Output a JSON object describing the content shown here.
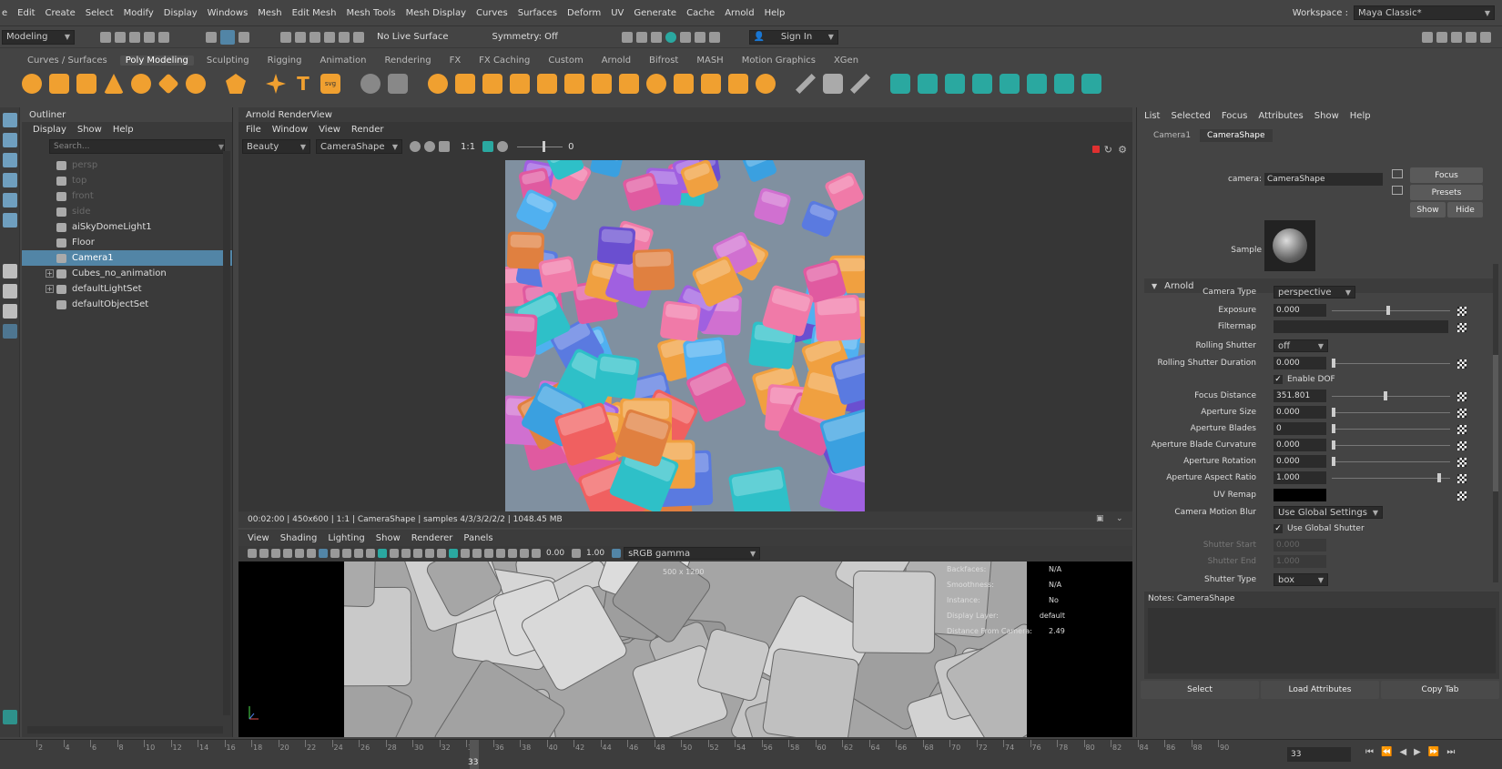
{
  "menubar": {
    "items": [
      "e",
      "Edit",
      "Create",
      "Select",
      "Modify",
      "Display",
      "Windows",
      "Mesh",
      "Edit Mesh",
      "Mesh Tools",
      "Mesh Display",
      "Curves",
      "Surfaces",
      "Deform",
      "UV",
      "Generate",
      "Cache",
      "Arnold",
      "Help"
    ],
    "workspace_label": "Workspace :",
    "workspace_value": "Maya Classic*"
  },
  "statusline": {
    "mode": "Modeling",
    "live_surface": "No Live Surface",
    "symmetry": "Symmetry: Off",
    "sign_in": "Sign In"
  },
  "shelf": {
    "tabs": [
      "Curves / Surfaces",
      "Poly Modeling",
      "Sculpting",
      "Rigging",
      "Animation",
      "Rendering",
      "FX",
      "FX Caching",
      "Custom",
      "Arnold",
      "Bifrost",
      "MASH",
      "Motion Graphics",
      "XGen"
    ],
    "active_tab": "Poly Modeling"
  },
  "outliner": {
    "title": "Outliner",
    "menu": [
      "Display",
      "Show",
      "Help"
    ],
    "search_placeholder": "Search...",
    "items": [
      {
        "label": "persp",
        "dim": true
      },
      {
        "label": "top",
        "dim": true
      },
      {
        "label": "front",
        "dim": true
      },
      {
        "label": "side",
        "dim": true
      },
      {
        "label": "aiSkyDomeLight1",
        "dim": false
      },
      {
        "label": "Floor",
        "dim": false
      },
      {
        "label": "Camera1",
        "dim": false,
        "selected": true
      },
      {
        "label": "Cubes_no_animation",
        "dim": false,
        "expandable": true
      },
      {
        "label": "defaultLightSet",
        "dim": false,
        "expandable": true
      },
      {
        "label": "defaultObjectSet",
        "dim": false
      }
    ]
  },
  "renderview": {
    "title": "Arnold RenderView",
    "menu": [
      "File",
      "Window",
      "View",
      "Render"
    ],
    "aov": "Beauty",
    "camera": "CameraShape",
    "ratio": "1:1",
    "slider_value": "0",
    "status": "00:02:00 | 450x600 | 1:1 | CameraShape  | samples 4/3/3/2/2/2 | 1048.45 MB"
  },
  "viewport": {
    "menu": [
      "View",
      "Shading",
      "Lighting",
      "Show",
      "Renderer",
      "Panels"
    ],
    "exposure": "0.00",
    "gamma": "1.00",
    "colorspace": "sRGB gamma",
    "resolution": "500 x 1200",
    "hud": [
      {
        "label": "Backfaces:",
        "value": "N/A"
      },
      {
        "label": "Smoothness:",
        "value": "N/A"
      },
      {
        "label": "Instance:",
        "value": "No"
      },
      {
        "label": "Display Layer:",
        "value": "default"
      },
      {
        "label": "Distance From Camera:",
        "value": "2.49"
      }
    ]
  },
  "attreditor": {
    "menu": [
      "List",
      "Selected",
      "Focus",
      "Attributes",
      "Show",
      "Help"
    ],
    "tabs": [
      "Camera1",
      "CameraShape"
    ],
    "camera_label": "camera:",
    "camera_value": "CameraShape",
    "focus_btn": "Focus",
    "presets_btn": "Presets",
    "show_btn": "Show",
    "hide_btn": "Hide",
    "sample_label": "Sample",
    "section": "Arnold",
    "camera_type_label": "Camera Type",
    "camera_type_value": "perspective",
    "attrs": [
      {
        "label": "Exposure",
        "value": "0.000",
        "knob": 0.48
      },
      {
        "label": "Filtermap",
        "value": "",
        "knob": null
      },
      {
        "label": "Rolling Shutter",
        "value": "off",
        "dropdown": true
      },
      {
        "label": "Rolling Shutter Duration",
        "value": "0.000",
        "knob": 0.0
      },
      {
        "label": "Focus Distance",
        "value": "351.801",
        "knob": 0.45
      },
      {
        "label": "Aperture Size",
        "value": "0.000",
        "knob": 0.0
      },
      {
        "label": "Aperture Blades",
        "value": "0",
        "knob": 0.0
      },
      {
        "label": "Aperture Blade Curvature",
        "value": "0.000",
        "knob": 0.0
      },
      {
        "label": "Aperture Rotation",
        "value": "0.000",
        "knob": 0.0
      },
      {
        "label": "Aperture Aspect Ratio",
        "value": "1.000",
        "knob": 0.92
      },
      {
        "label": "UV Remap",
        "value": "",
        "knob": null
      }
    ],
    "enable_dof": "Enable DOF",
    "motion_blur_label": "Camera Motion Blur",
    "motion_blur_value": "Use Global Settings",
    "use_global_shutter": "Use Global Shutter",
    "shutter_start_label": "Shutter Start",
    "shutter_start_value": "0.000",
    "shutter_end_label": "Shutter End",
    "shutter_end_value": "1.000",
    "shutter_type_label": "Shutter Type",
    "shutter_type_value": "box",
    "notes": "Notes:  CameraShape",
    "buttons": [
      "Select",
      "Load Attributes",
      "Copy Tab"
    ]
  },
  "timeslider": {
    "ticks": [
      "2",
      "4",
      "6",
      "8",
      "10",
      "12",
      "14",
      "16",
      "18",
      "20",
      "22",
      "24",
      "26",
      "28",
      "30",
      "32",
      "34",
      "36",
      "38",
      "40",
      "42",
      "44",
      "46",
      "48",
      "50",
      "52",
      "54",
      "56",
      "58",
      "60",
      "62",
      "64",
      "66",
      "68",
      "70",
      "72",
      "74",
      "76",
      "78",
      "80",
      "82",
      "84",
      "86",
      "88",
      "90"
    ],
    "current_frame": "33",
    "frame_field": "33"
  },
  "colors": {
    "selection": "#5285a6",
    "accent_red": "#e03030",
    "shelf_orange": "#f0a030",
    "shelf_teal": "#2aa8a0"
  }
}
